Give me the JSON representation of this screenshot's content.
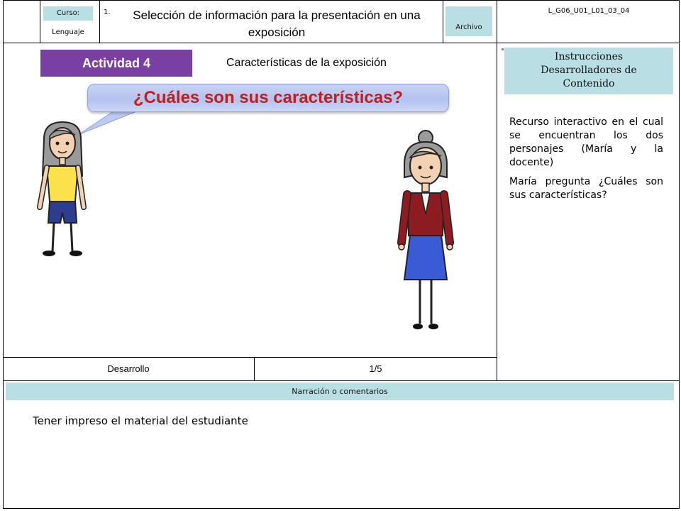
{
  "header": {
    "course_label": "Curso:",
    "course_value": "Lenguaje",
    "number": "1.",
    "title": "Selección de información para la presentación en una exposición",
    "file_label": "Archivo",
    "file_code": "L_G06_U01_L01_03_04"
  },
  "activity": {
    "badge": "Actividad 4",
    "subtitle": "Características de la exposición",
    "question": "¿Cuáles son sus características?",
    "characters": [
      "María",
      "docente"
    ]
  },
  "instructions": {
    "heading": "Instrucciones Desarrolladores de Contenido",
    "paragraphs": [
      "Recurso interactivo en el cual se encuentran los dos personajes (María y la docente)",
      "María pregunta ¿Cuáles son sus características?"
    ]
  },
  "footer_row": {
    "stage": "Desarrollo",
    "page": "1/5"
  },
  "narration": {
    "heading": "Narración o comentarios",
    "text": "Tener impreso el material del estudiante"
  },
  "colors": {
    "chip": "#b9dfe4",
    "activity_badge": "#7a3fa3",
    "question_text": "#c0201d",
    "question_bg": "#b3c2f0"
  }
}
